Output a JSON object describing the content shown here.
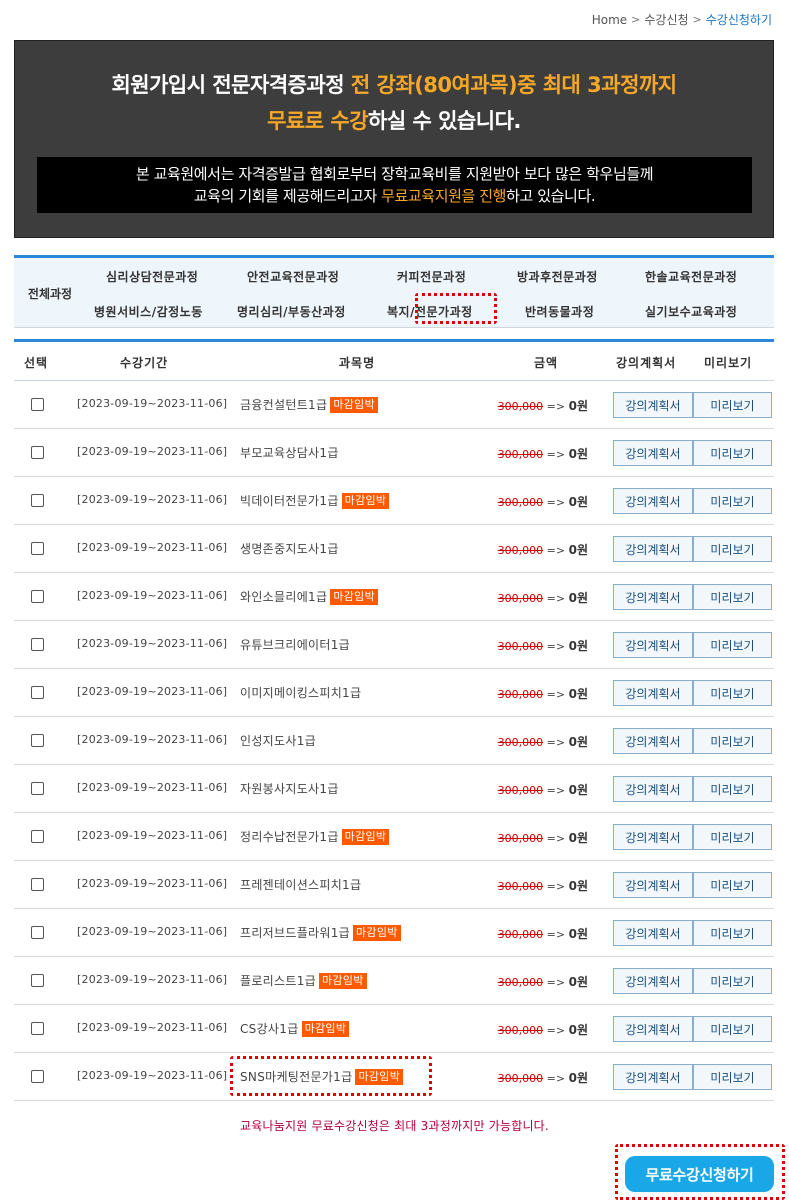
{
  "breadcrumb": {
    "home": "Home",
    "level1": "수강신청",
    "current": "수강신청하기"
  },
  "banner": {
    "line1_a": "회원가입시 전문자격증과정 ",
    "line1_b": "전 강좌(80여과목)중 최대 3과정까지",
    "line2_a": "무료로 수강",
    "line2_b": "하실 수 있습니다.",
    "box_line1": "본 교육원에서는 자격증발급 협회로부터 장학교육비를 지원받아 보다 많은 학우님들께",
    "box_line2_a": "교육의 기회를 제공해드리고자 ",
    "box_line2_b": "무료교육지원을 진행",
    "box_line2_c": "하고 있습니다."
  },
  "categories": {
    "all": "전체과정",
    "row1": [
      "심리상담전문과정",
      "안전교육전문과정",
      "커피전문과정",
      "방과후전문과정",
      "한솔교육전문과정"
    ],
    "row2": [
      "병원서비스/감정노동",
      "명리심리/부동산과정",
      "복지/전문가과정",
      "반려동물과정",
      "실기보수교육과정"
    ]
  },
  "table": {
    "headers": {
      "select": "선택",
      "period": "수강기간",
      "name": "과목명",
      "price": "금액",
      "plan": "강의계획서",
      "preview": "미리보기"
    },
    "rows": [
      {
        "period": "[2023-09-19~2023-11-06]",
        "name": "금융컨설턴트1급",
        "badge": "마감임박",
        "orig": "300,000",
        "arrow": " => ",
        "final": "0원",
        "plan": "강의계획서",
        "preview": "미리보기"
      },
      {
        "period": "[2023-09-19~2023-11-06]",
        "name": "부모교육상담사1급",
        "badge": "",
        "orig": "300,000",
        "arrow": " => ",
        "final": "0원",
        "plan": "강의계획서",
        "preview": "미리보기"
      },
      {
        "period": "[2023-09-19~2023-11-06]",
        "name": "빅데이터전문가1급",
        "badge": "마감임박",
        "orig": "300,000",
        "arrow": " => ",
        "final": "0원",
        "plan": "강의계획서",
        "preview": "미리보기"
      },
      {
        "period": "[2023-09-19~2023-11-06]",
        "name": "생명존중지도사1급",
        "badge": "",
        "orig": "300,000",
        "arrow": " => ",
        "final": "0원",
        "plan": "강의계획서",
        "preview": "미리보기"
      },
      {
        "period": "[2023-09-19~2023-11-06]",
        "name": "와인소믈리에1급",
        "badge": "마감임박",
        "orig": "300,000",
        "arrow": " => ",
        "final": "0원",
        "plan": "강의계획서",
        "preview": "미리보기"
      },
      {
        "period": "[2023-09-19~2023-11-06]",
        "name": "유튜브크리에이터1급",
        "badge": "",
        "orig": "300,000",
        "arrow": " => ",
        "final": "0원",
        "plan": "강의계획서",
        "preview": "미리보기"
      },
      {
        "period": "[2023-09-19~2023-11-06]",
        "name": "이미지메이킹스피치1급",
        "badge": "",
        "orig": "300,000",
        "arrow": " => ",
        "final": "0원",
        "plan": "강의계획서",
        "preview": "미리보기"
      },
      {
        "period": "[2023-09-19~2023-11-06]",
        "name": "인성지도사1급",
        "badge": "",
        "orig": "300,000",
        "arrow": " => ",
        "final": "0원",
        "plan": "강의계획서",
        "preview": "미리보기"
      },
      {
        "period": "[2023-09-19~2023-11-06]",
        "name": "자원봉사지도사1급",
        "badge": "",
        "orig": "300,000",
        "arrow": " => ",
        "final": "0원",
        "plan": "강의계획서",
        "preview": "미리보기"
      },
      {
        "period": "[2023-09-19~2023-11-06]",
        "name": "정리수납전문가1급",
        "badge": "마감임박",
        "orig": "300,000",
        "arrow": " => ",
        "final": "0원",
        "plan": "강의계획서",
        "preview": "미리보기"
      },
      {
        "period": "[2023-09-19~2023-11-06]",
        "name": "프레젠테이션스피치1급",
        "badge": "",
        "orig": "300,000",
        "arrow": " => ",
        "final": "0원",
        "plan": "강의계획서",
        "preview": "미리보기"
      },
      {
        "period": "[2023-09-19~2023-11-06]",
        "name": "프리저브드플라워1급",
        "badge": "마감임박",
        "orig": "300,000",
        "arrow": " => ",
        "final": "0원",
        "plan": "강의계획서",
        "preview": "미리보기"
      },
      {
        "period": "[2023-09-19~2023-11-06]",
        "name": "플로리스트1급",
        "badge": "마감임박",
        "orig": "300,000",
        "arrow": " => ",
        "final": "0원",
        "plan": "강의계획서",
        "preview": "미리보기"
      },
      {
        "period": "[2023-09-19~2023-11-06]",
        "name": "CS강사1급",
        "badge": "마감임박",
        "orig": "300,000",
        "arrow": " => ",
        "final": "0원",
        "plan": "강의계획서",
        "preview": "미리보기"
      },
      {
        "period": "[2023-09-19~2023-11-06]",
        "name": "SNS마케팅전문가1급",
        "badge": "마감임박",
        "orig": "300,000",
        "arrow": " => ",
        "final": "0원",
        "plan": "강의계획서",
        "preview": "미리보기"
      }
    ]
  },
  "notice": "교육나눔지원 무료수강신청은 최대 3과정까지만 가능합니다.",
  "apply_button": "무료수강신청하기",
  "colors": {
    "accent_blue": "#2b88d8",
    "highlight_orange": "#f7a828",
    "badge_orange": "#ff5a00",
    "annotation_red": "#e00000",
    "apply_blue": "#1aa7e8"
  }
}
